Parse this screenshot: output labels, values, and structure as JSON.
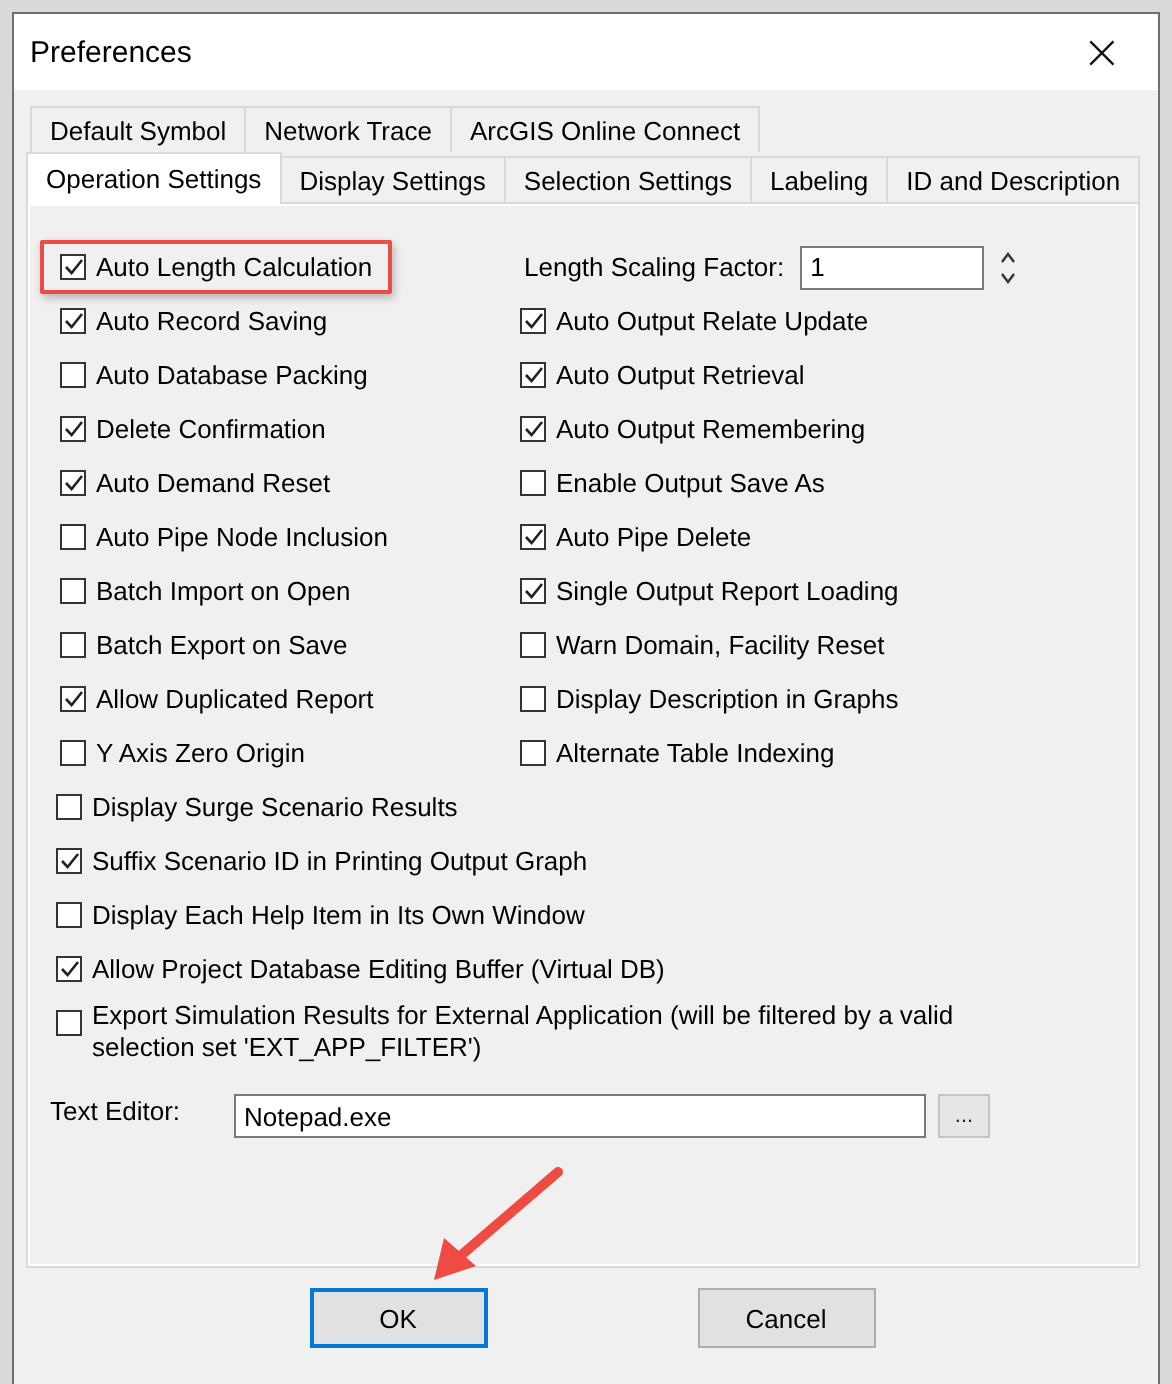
{
  "window": {
    "title": "Preferences",
    "close": "×"
  },
  "tabs": [
    [
      {
        "label": "Default Symbol",
        "selected": false
      },
      {
        "label": "Network Trace",
        "selected": false
      },
      {
        "label": "ArcGIS Online Connect",
        "selected": false
      }
    ],
    [
      {
        "label": "Operation Settings",
        "selected": true
      },
      {
        "label": "Display Settings",
        "selected": false
      },
      {
        "label": "Selection Settings",
        "selected": false
      },
      {
        "label": "Labeling",
        "selected": false
      },
      {
        "label": "ID and Description",
        "selected": false
      }
    ]
  ],
  "left_column": [
    {
      "label": "Auto Length Calculation",
      "checked": true,
      "highlighted": true
    },
    {
      "label": "Auto Record Saving",
      "checked": true,
      "highlighted": false
    },
    {
      "label": "Auto Database Packing",
      "checked": false,
      "highlighted": false
    },
    {
      "label": "Delete Confirmation",
      "checked": true,
      "highlighted": false
    },
    {
      "label": "Auto Demand Reset",
      "checked": true,
      "highlighted": false
    },
    {
      "label": "Auto Pipe Node Inclusion",
      "checked": false,
      "highlighted": false
    },
    {
      "label": "Batch Import on Open",
      "checked": false,
      "highlighted": false
    },
    {
      "label": "Batch Export on Save",
      "checked": false,
      "highlighted": false
    },
    {
      "label": "Allow Duplicated Report",
      "checked": true,
      "highlighted": false
    },
    {
      "label": "Y Axis Zero Origin",
      "checked": false,
      "highlighted": false
    }
  ],
  "right_column": {
    "scaling_factor": {
      "label": "Length Scaling Factor:",
      "value": "1"
    },
    "items": [
      {
        "label": "Auto Output Relate Update",
        "checked": true
      },
      {
        "label": "Auto Output Retrieval",
        "checked": true
      },
      {
        "label": "Auto Output Remembering",
        "checked": true
      },
      {
        "label": "Enable Output Save As",
        "checked": false
      },
      {
        "label": "Auto Pipe Delete",
        "checked": true
      },
      {
        "label": "Single Output Report Loading",
        "checked": true
      },
      {
        "label": "Warn Domain, Facility Reset",
        "checked": false
      },
      {
        "label": "Display Description in Graphs",
        "checked": false
      },
      {
        "label": "Alternate Table Indexing",
        "checked": false
      }
    ]
  },
  "full_width": [
    {
      "label": "Display Surge Scenario Results",
      "checked": false
    },
    {
      "label": "Suffix Scenario ID in Printing Output Graph",
      "checked": true
    },
    {
      "label": "Display Each Help Item in Its Own Window",
      "checked": false
    },
    {
      "label": "Allow Project Database Editing Buffer (Virtual DB)",
      "checked": true
    },
    {
      "label": "Export Simulation Results for External Application (will be filtered by a valid selection set 'EXT_APP_FILTER')",
      "checked": false
    }
  ],
  "text_editor": {
    "label": "Text Editor:",
    "value": "Notepad.exe",
    "browse": "..."
  },
  "buttons": [
    {
      "label": "OK",
      "pointed_at": true,
      "default": true
    },
    {
      "label": "Cancel",
      "pointed_at": false,
      "default": false
    }
  ]
}
